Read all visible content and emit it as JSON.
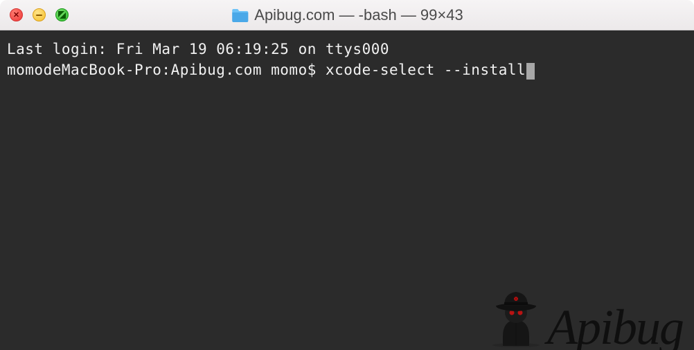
{
  "window": {
    "title": "Apibug.com — -bash — 99×43"
  },
  "terminal": {
    "last_login": "Last login: Fri Mar 19 06:19:25 on ttys000",
    "prompt": "momodeMacBook-Pro:Apibug.com momo$ ",
    "command": "xcode-select --install"
  },
  "watermark": {
    "text": "Apibug"
  }
}
